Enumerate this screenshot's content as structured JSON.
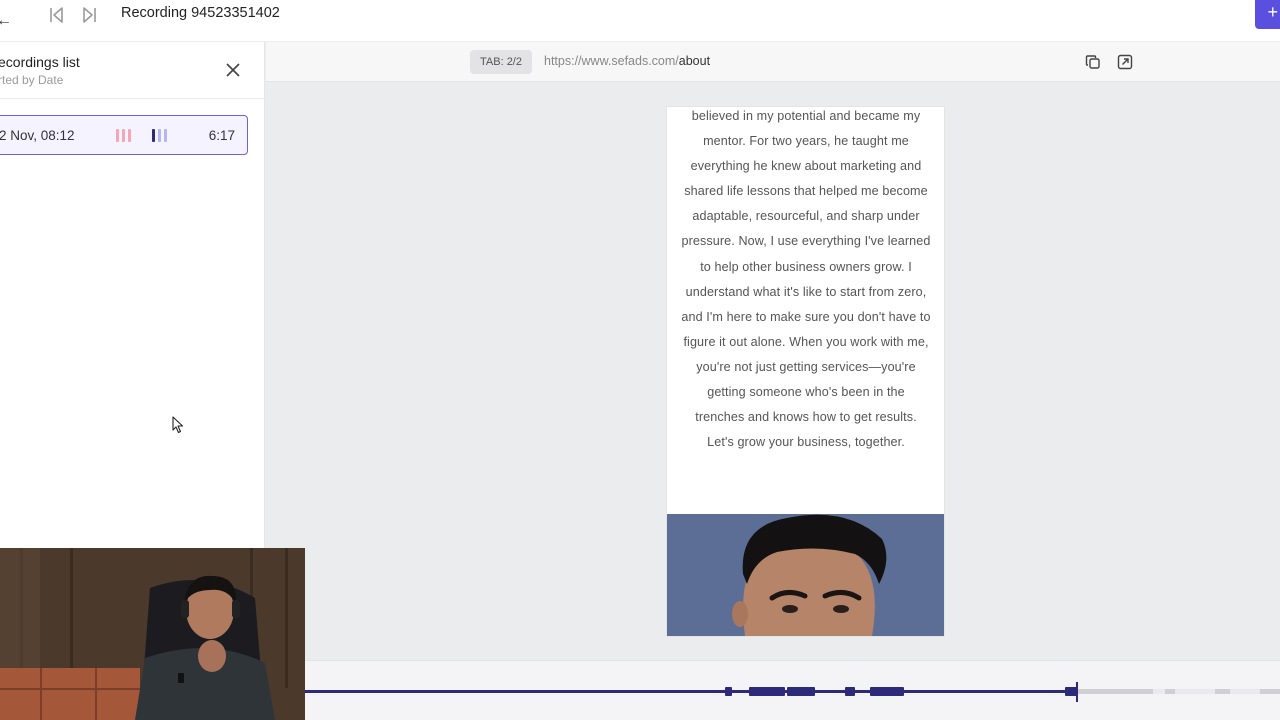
{
  "header": {
    "back_glyph": "←",
    "title": "Recording 94523351402",
    "plus_glyph": "+",
    "accent_color": "#5b4fe0"
  },
  "sidebar": {
    "title": "ecordings list",
    "subtitle": "rted by Date",
    "items": [
      {
        "date": "2 Nov, 08:12",
        "duration": "6:17",
        "bar_colors": [
          "#f4a6b3",
          "#2d2a7a",
          "#b9b3f0"
        ]
      }
    ]
  },
  "url_bar": {
    "tab_badge": "TAB: 2/2",
    "url_base": "https://www.sefads.com/",
    "url_path": "about"
  },
  "preview": {
    "paragraph": "believed in my potential and became my mentor. For two years, he taught me everything he knew about marketing and shared life lessons that helped me become adaptable, resourceful, and sharp under pressure. Now, I use everything I've learned to help other business owners grow. I understand what it's like to start from zero, and I'm here to make sure you don't have to figure it out alone. When you work with me, you're not just getting services—you're getting someone who's been in the trenches and knows how to get results. Let's grow your business, together.",
    "photo_bg": "#5c6e96"
  },
  "timeline": {
    "played_color": "#2d2a7a",
    "remaining_color": "#cfcfd4"
  }
}
